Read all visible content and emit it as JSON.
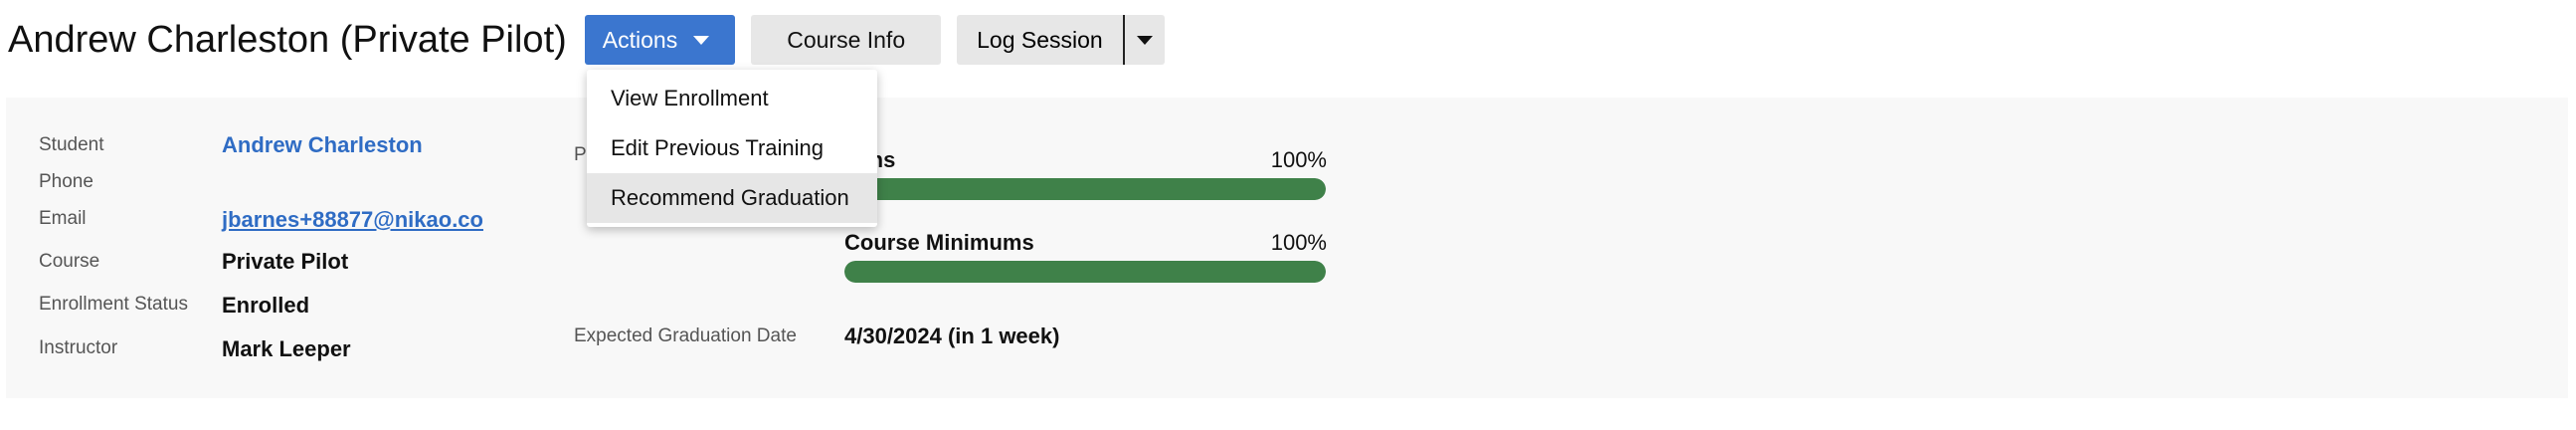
{
  "header": {
    "title": "Andrew Charleston (Private Pilot)",
    "actions_label": "Actions",
    "course_info_label": "Course Info",
    "log_session_label": "Log Session"
  },
  "actions_menu": {
    "items": [
      {
        "label": "View Enrollment"
      },
      {
        "label": "Edit Previous Training"
      },
      {
        "label": "Recommend Graduation",
        "highlighted": true
      }
    ]
  },
  "details": {
    "student_label": "Student",
    "student_value": "Andrew Charleston",
    "phone_label": "Phone",
    "phone_value": "",
    "email_label": "Email",
    "email_value": "jbarnes+88877@nikao.co",
    "course_label": "Course",
    "course_value": "Private Pilot",
    "status_label": "Enrollment Status",
    "status_value": "Enrolled",
    "instructor_label": "Instructor",
    "instructor_value": "Mark Leeper"
  },
  "progress": {
    "section_label_visible": "P",
    "lessons": {
      "label": "Lessons",
      "label_visible": "sons",
      "percent_text": "100%",
      "value": 100
    },
    "minimums": {
      "label": "Course Minimums",
      "percent_text": "100%",
      "value": 100
    },
    "graduation_label": "Expected Graduation Date",
    "graduation_value": "4/30/2024 (in 1 week)"
  },
  "colors": {
    "primary": "#3b76cf",
    "progress": "#3f8149",
    "link": "#2f6cc4",
    "panel_bg": "#f8f8f8",
    "button_gray": "#e7e7e7"
  },
  "icons": {
    "actions_caret": "chevron-down-icon",
    "log_session_caret": "chevron-down-icon"
  }
}
